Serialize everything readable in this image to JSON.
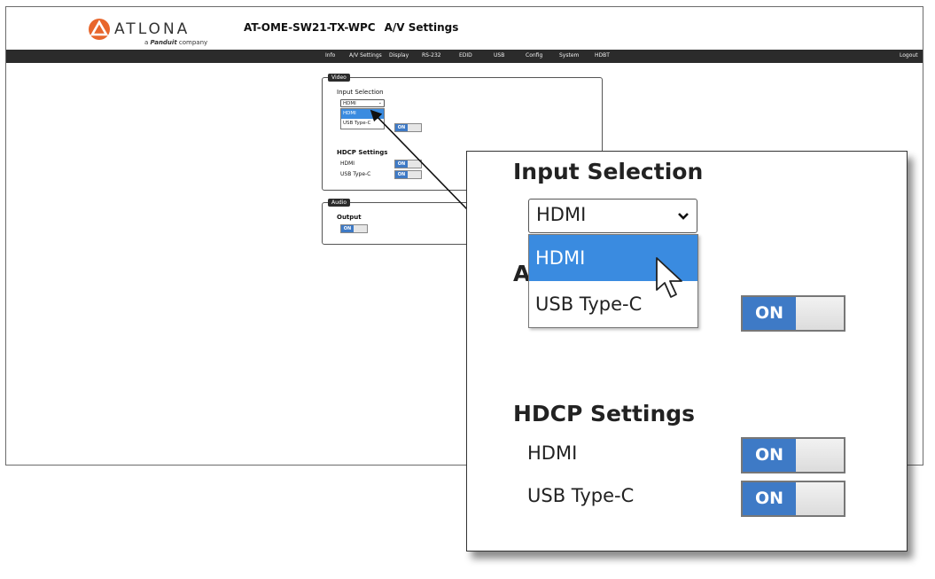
{
  "header": {
    "logo_word": "ATLONA",
    "logo_sub_prefix": "a",
    "logo_sub_brand": "Panduit",
    "logo_sub_suffix": "company",
    "model": "AT-OME-SW21-TX-WPC",
    "page": "A/V Settings"
  },
  "nav": {
    "items": [
      "Info",
      "A/V Settings",
      "Display",
      "RS-232",
      "EDID",
      "USB",
      "Config",
      "System",
      "HDBT"
    ],
    "logout": "Logout"
  },
  "video": {
    "tab": "Video",
    "input_selection_label": "Input Selection",
    "input_value": "HDMI",
    "input_options": [
      "HDMI",
      "USB Type-C"
    ],
    "hidden_letter": "A",
    "hdcp_label": "HDCP Settings",
    "hdcp_hdmi": "HDMI",
    "hdcp_usbc": "USB Type-C",
    "toggle_on": "ON"
  },
  "audio": {
    "tab": "Audio",
    "output_label": "Output",
    "toggle_on": "ON"
  },
  "colors": {
    "nav_bg": "#2b2b2b",
    "selected": "#3a8be0",
    "toggle_on": "#3e7ac6",
    "logo_orange": "#e8662c"
  },
  "icons": {
    "logo": "atlona-logo-icon",
    "chevron": "chevron-down-icon",
    "cursor": "mouse-pointer-icon"
  }
}
